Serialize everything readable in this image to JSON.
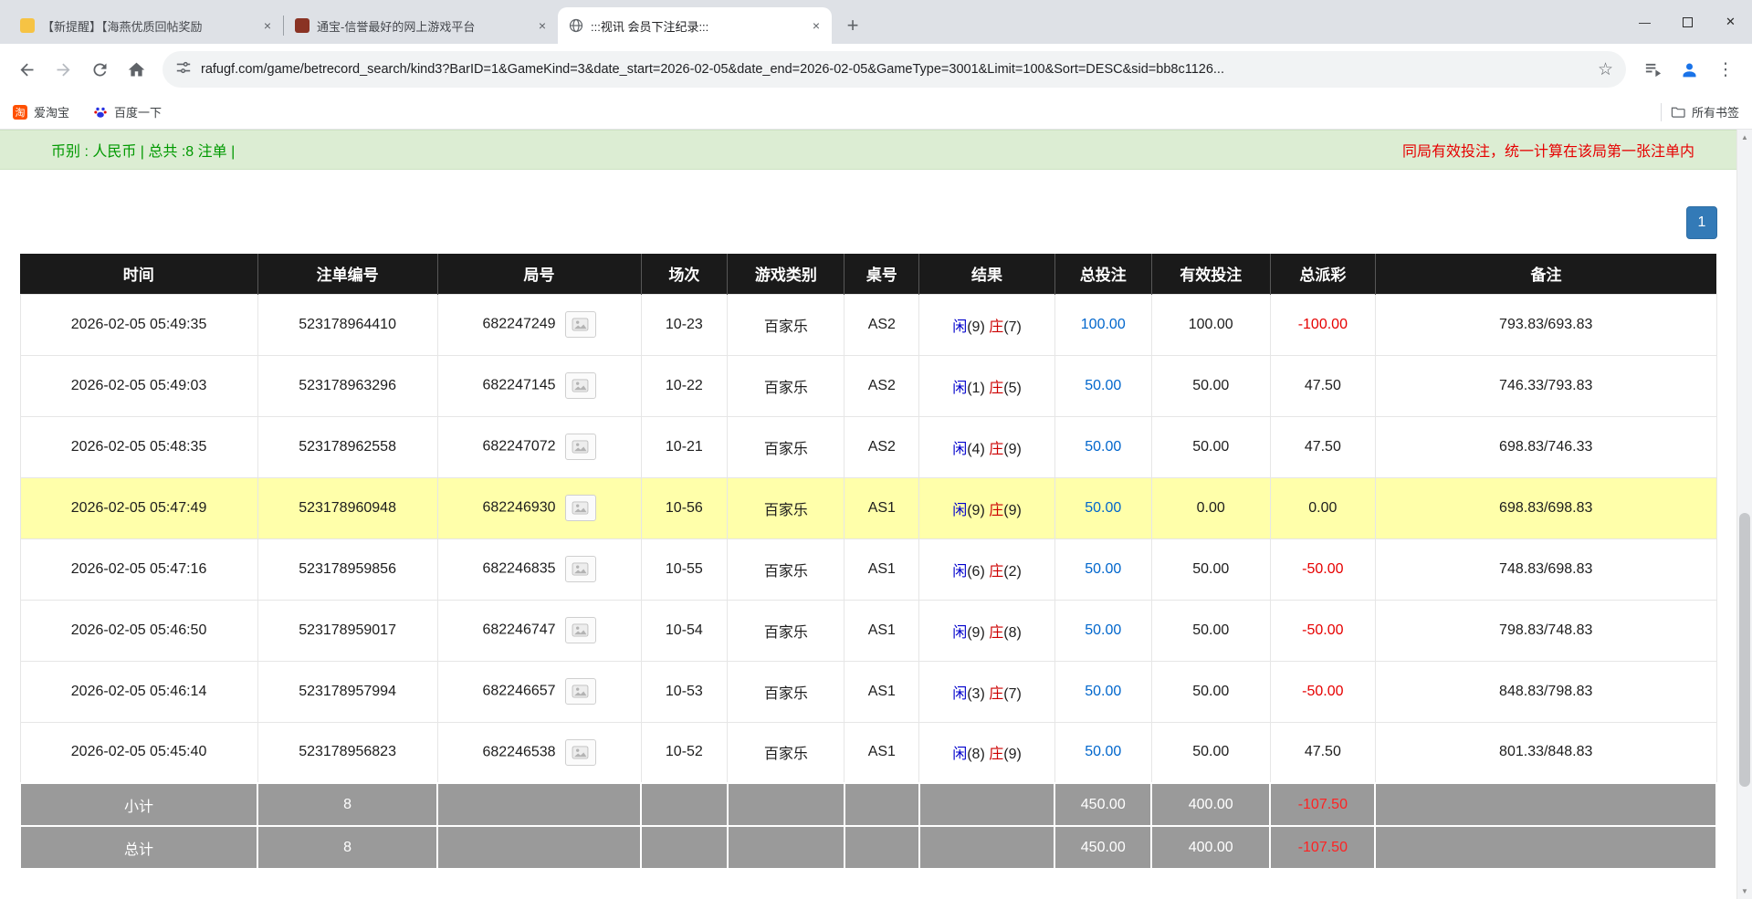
{
  "colors": {
    "green_text": "#009900",
    "notice_red": "#e60000",
    "info_bar_green": "#dcedd3",
    "amount_blue": "#0066cc",
    "player_blue": "#0000cc",
    "banker_red": "#cc0000",
    "negative_red": "#e60000",
    "table_header_bg": "#1a1a1a",
    "footer_gray": "#9a9a9a",
    "highlight_yellow": "#ffffaa",
    "pagination_blue": "#337ab7"
  },
  "glyphs": {
    "tab_close": "×",
    "new_tab": "+",
    "minimize": "—",
    "close_window": "✕",
    "menu_dots": "⋮",
    "star": "☆",
    "scroll_up": "▲",
    "scroll_down": "▼"
  },
  "browser": {
    "tabs": [
      {
        "title": "【新提醒】【海燕优质回帖奖励"
      },
      {
        "title": "通宝-信誉最好的网上游戏平台"
      },
      {
        "title": ":::视讯 会员下注纪录:::"
      }
    ],
    "url": "rafugf.com/game/betrecord_search/kind3?BarID=1&GameKind=3&date_start=2026-02-05&date_end=2026-02-05&GameType=3001&Limit=100&Sort=DESC&sid=bb8c1126...",
    "bookmarks": [
      {
        "label": "爱淘宝"
      },
      {
        "label": "百度一下"
      }
    ],
    "taobao_icon_char": "淘",
    "all_bookmarks_label": "所有书签"
  },
  "page": {
    "info_left": "币别 : 人民币 | 总共 :8 注单 |",
    "info_right": "同局有效投注，统一计算在该局第一张注单内",
    "pagination_label": "1"
  },
  "table": {
    "headers": [
      "时间",
      "注单编号",
      "局号",
      "场次",
      "游戏类别",
      "桌号",
      "结果",
      "总投注",
      "有效投注",
      "总派彩",
      "备注"
    ],
    "rows": [
      {
        "time": "2026-02-05 05:49:35",
        "bet_id": "523178964410",
        "round_id": "682247249",
        "session": "10-23",
        "game_type": "百家乐",
        "table_no": "AS2",
        "result": {
          "player_label": "闲",
          "player_score": "(9)",
          "banker_label": "庄",
          "banker_score": "(7)"
        },
        "total_bet": "100.00",
        "valid_bet": "100.00",
        "payout": "-100.00",
        "remark": "793.83/693.83",
        "highlighted": false
      },
      {
        "time": "2026-02-05 05:49:03",
        "bet_id": "523178963296",
        "round_id": "682247145",
        "session": "10-22",
        "game_type": "百家乐",
        "table_no": "AS2",
        "result": {
          "player_label": "闲",
          "player_score": "(1)",
          "banker_label": "庄",
          "banker_score": "(5)"
        },
        "total_bet": "50.00",
        "valid_bet": "50.00",
        "payout": "47.50",
        "remark": "746.33/793.83",
        "highlighted": false
      },
      {
        "time": "2026-02-05 05:48:35",
        "bet_id": "523178962558",
        "round_id": "682247072",
        "session": "10-21",
        "game_type": "百家乐",
        "table_no": "AS2",
        "result": {
          "player_label": "闲",
          "player_score": "(4)",
          "banker_label": "庄",
          "banker_score": "(9)"
        },
        "total_bet": "50.00",
        "valid_bet": "50.00",
        "payout": "47.50",
        "remark": "698.83/746.33",
        "highlighted": false
      },
      {
        "time": "2026-02-05 05:47:49",
        "bet_id": "523178960948",
        "round_id": "682246930",
        "session": "10-56",
        "game_type": "百家乐",
        "table_no": "AS1",
        "result": {
          "player_label": "闲",
          "player_score": "(9)",
          "banker_label": "庄",
          "banker_score": "(9)"
        },
        "total_bet": "50.00",
        "valid_bet": "0.00",
        "payout": "0.00",
        "remark": "698.83/698.83",
        "highlighted": true
      },
      {
        "time": "2026-02-05 05:47:16",
        "bet_id": "523178959856",
        "round_id": "682246835",
        "session": "10-55",
        "game_type": "百家乐",
        "table_no": "AS1",
        "result": {
          "player_label": "闲",
          "player_score": "(6)",
          "banker_label": "庄",
          "banker_score": "(2)"
        },
        "total_bet": "50.00",
        "valid_bet": "50.00",
        "payout": "-50.00",
        "remark": "748.83/698.83",
        "highlighted": false
      },
      {
        "time": "2026-02-05 05:46:50",
        "bet_id": "523178959017",
        "round_id": "682246747",
        "session": "10-54",
        "game_type": "百家乐",
        "table_no": "AS1",
        "result": {
          "player_label": "闲",
          "player_score": "(9)",
          "banker_label": "庄",
          "banker_score": "(8)"
        },
        "total_bet": "50.00",
        "valid_bet": "50.00",
        "payout": "-50.00",
        "remark": "798.83/748.83",
        "highlighted": false
      },
      {
        "time": "2026-02-05 05:46:14",
        "bet_id": "523178957994",
        "round_id": "682246657",
        "session": "10-53",
        "game_type": "百家乐",
        "table_no": "AS1",
        "result": {
          "player_label": "闲",
          "player_score": "(3)",
          "banker_label": "庄",
          "banker_score": "(7)"
        },
        "total_bet": "50.00",
        "valid_bet": "50.00",
        "payout": "-50.00",
        "remark": "848.83/798.83",
        "highlighted": false
      },
      {
        "time": "2026-02-05 05:45:40",
        "bet_id": "523178956823",
        "round_id": "682246538",
        "session": "10-52",
        "game_type": "百家乐",
        "table_no": "AS1",
        "result": {
          "player_label": "闲",
          "player_score": "(8)",
          "banker_label": "庄",
          "banker_score": "(9)"
        },
        "total_bet": "50.00",
        "valid_bet": "50.00",
        "payout": "47.50",
        "remark": "801.33/848.83",
        "highlighted": false
      }
    ],
    "footer_rows": [
      {
        "label": "小计",
        "count": "8",
        "total_bet": "450.00",
        "valid_bet": "400.00",
        "payout": "-107.50"
      },
      {
        "label": "总计",
        "count": "8",
        "total_bet": "450.00",
        "valid_bet": "400.00",
        "payout": "-107.50"
      }
    ]
  }
}
